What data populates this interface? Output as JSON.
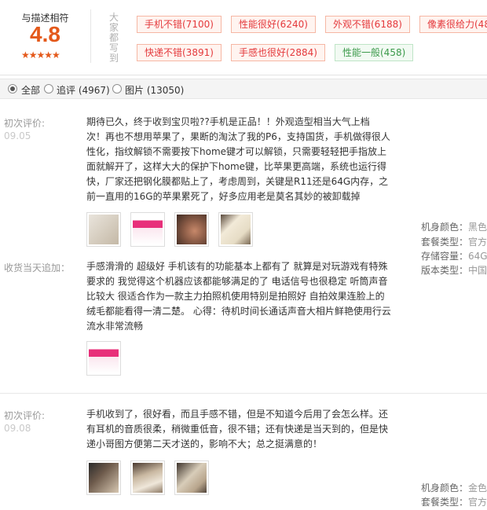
{
  "summary": {
    "label": "与描述相符",
    "score": "4.8",
    "stars": "★★★★★",
    "impressions_label": "大家都写到"
  },
  "tags": [
    {
      "text": "手机不错(7100)",
      "type": "positive"
    },
    {
      "text": "性能很好(6240)",
      "type": "positive"
    },
    {
      "text": "外观不错(6188)",
      "type": "positive"
    },
    {
      "text": "像素很给力(48",
      "type": "positive"
    },
    {
      "text": "快递不错(3891)",
      "type": "positive"
    },
    {
      "text": "手感也很好(2884)",
      "type": "positive"
    },
    {
      "text": "性能一般(458)",
      "type": "neutral"
    }
  ],
  "filters": [
    {
      "label": "全部",
      "checked": true
    },
    {
      "label": "追评 (4967)",
      "checked": false
    },
    {
      "label": "图片 (13050)",
      "checked": false
    }
  ],
  "reviews": [
    {
      "first_label": "初次评价:",
      "first_date": "09.05",
      "first_text": [
        "期待已久，终于收到宝贝啦??手机是正品！！外观造型相当大气上档",
        "次！再也不想用苹果了，果断的淘汰了我的P6，支持国货，手机做得很人",
        "性化，指纹解锁不需要按下home键才可以解锁，只需要轻轻把手指放上",
        "面就解开了，这样大大的保护下home键，比苹果更高端，系统也运行得",
        "快，厂家还把钢化膜都贴上了，考虑周到，关键是R11还是64G内存，之",
        "前一直用的16G的苹果累死了，好多应用老是莫名其妙的被卸载掉"
      ],
      "thumbs": [
        "phone-photo-1",
        "screenshot-photo",
        "hand-photo",
        "phone-photo-2"
      ],
      "followup_label": "收货当天追加：",
      "followup_text": [
        "手感滑滑的 超级好 手机该有的功能基本上都有了 就算是对玩游戏有特殊",
        "要求的 我觉得这个机器应该都能够满足的了 电话信号也很稳定 听筒声音",
        "比较大 很适合作为一款主力拍照机使用特别是拍照好 自拍效果连脸上的",
        "绒毛都能看得一清二楚。 心得：待机时间长通话声音大相片鲜艳使用行云",
        "流水非常流畅"
      ],
      "followup_thumbs": [
        "screenshot-photo"
      ],
      "specs": [
        {
          "key": "机身颜色：",
          "value": "黑色"
        },
        {
          "key": "套餐类型：",
          "value": "官方"
        },
        {
          "key": "存储容量：",
          "value": "64G"
        },
        {
          "key": "版本类型：",
          "value": "中国"
        }
      ]
    },
    {
      "first_label": "初次评价:",
      "first_date": "09.08",
      "first_text": [
        "手机收到了，很好看，而且手感不错，但是不知道今后用了会怎么样。还",
        "有耳机的音质很柔，稍微重低音，很不错；还有快递是当天到的，但是快",
        "递小哥图方便第二天才送的，影响不大；总之挺满意的！"
      ],
      "thumbs": [
        "box-photo-1",
        "box-photo-2",
        "phone-photo-3"
      ],
      "specs": [
        {
          "key": "机身颜色：",
          "value": "金色"
        },
        {
          "key": "套餐类型：",
          "value": "官方"
        }
      ]
    }
  ]
}
